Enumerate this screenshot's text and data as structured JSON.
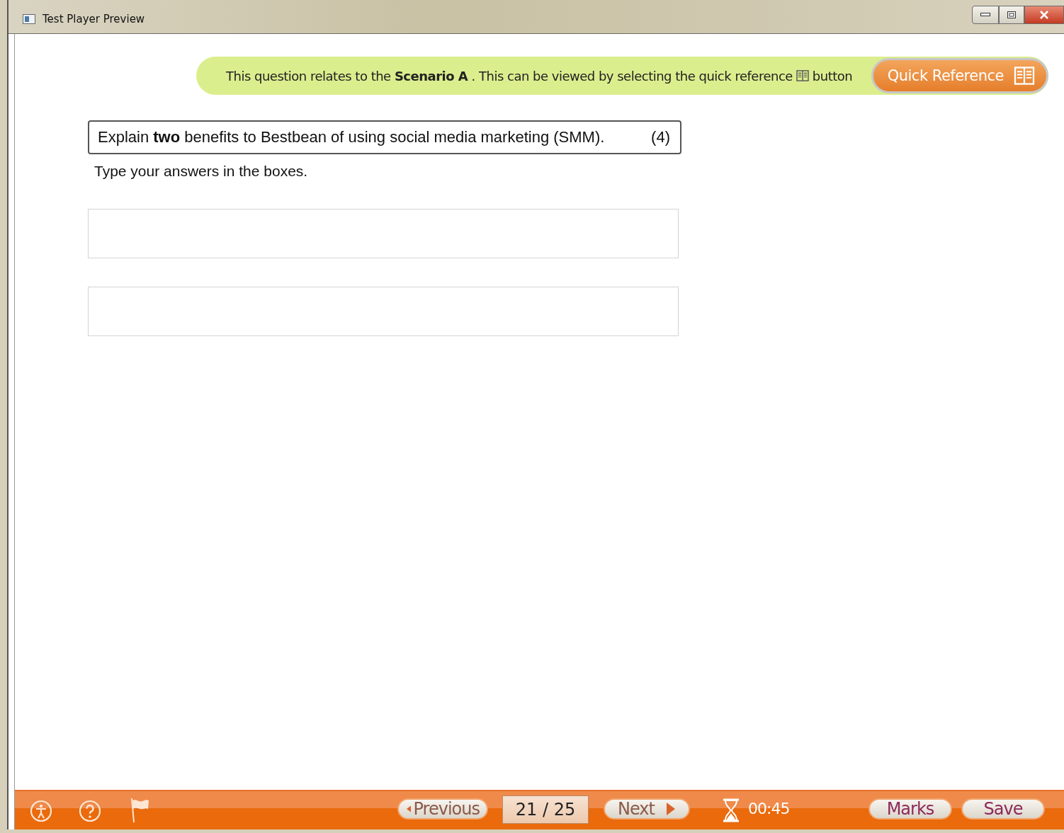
{
  "window": {
    "title": "Test Player Preview"
  },
  "banner": {
    "text": "This question relates to the **Scenario A** . This can be viewed by selecting the quick reference",
    "text_after": "button",
    "button": "Quick Reference"
  },
  "question": {
    "text": "Explain **two** benefits to Bestbean of using social media marketing (SMM).",
    "marks": "(4)",
    "instruction": "Type your answers in the boxes."
  },
  "answers": [
    {
      "kind": "textbox"
    },
    {
      "kind": "textbox"
    }
  ],
  "footer": {
    "previous": "Previous",
    "counter": "21 / 25",
    "next": "Next",
    "timer": "00:45",
    "buttons": [
      "Marks",
      "Save"
    ]
  }
}
